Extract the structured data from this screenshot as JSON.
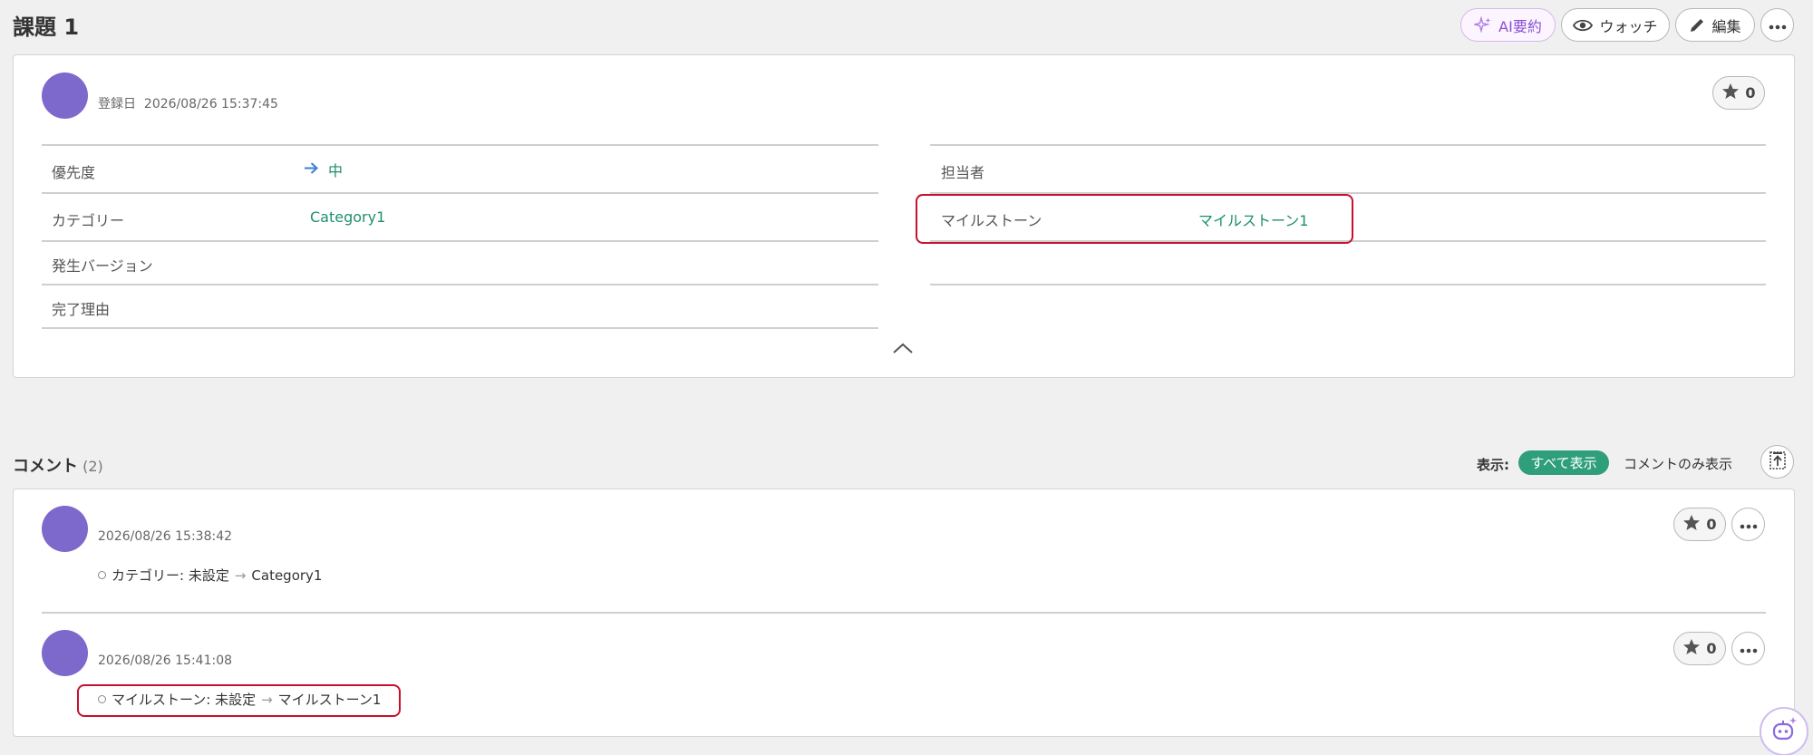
{
  "issue": {
    "title": "課題 1"
  },
  "header_actions": {
    "ai_summary": "AI要約",
    "watch": "ウォッチ",
    "edit": "編集"
  },
  "detail": {
    "created_label": "登録日",
    "created_at": "2026/08/26 15:37:45",
    "star_count": "0",
    "properties_left": [
      {
        "label": "優先度",
        "value": "中"
      },
      {
        "label": "カテゴリー",
        "value": "Category1"
      },
      {
        "label": "発生バージョン",
        "value": ""
      },
      {
        "label": "完了理由",
        "value": ""
      }
    ],
    "properties_right": [
      {
        "label": "担当者",
        "value": ""
      },
      {
        "label": "マイルストーン",
        "value": "マイルストーン1"
      }
    ]
  },
  "comments": {
    "title": "コメント",
    "count": "(2)",
    "display_label": "表示:",
    "filter_all": "すべて表示",
    "filter_comments_only": "コメントのみ表示",
    "items": [
      {
        "timestamp": "2026/08/26 15:38:42",
        "star_count": "0",
        "change_field": "カテゴリー: 未設定",
        "change_arrow": "→",
        "change_to": "Category1"
      },
      {
        "timestamp": "2026/08/26 15:41:08",
        "star_count": "0",
        "change_field": "マイルストーン: 未設定",
        "change_arrow": "→",
        "change_to": "マイルストーン1"
      }
    ]
  },
  "colors": {
    "accent_green": "#1e8f6e",
    "avatar": "#7d68cc",
    "highlight_red": "#c8102e",
    "ai_purple": "#8a4fd6"
  }
}
